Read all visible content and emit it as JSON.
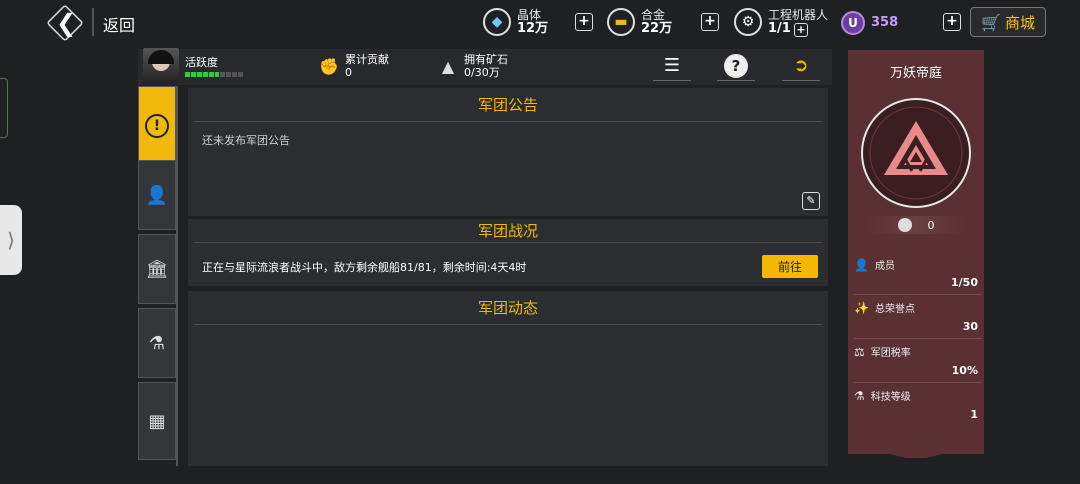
{
  "topbar": {
    "back_label": "返回",
    "resources": [
      {
        "name": "晶体",
        "value": "12万",
        "icon": "crystal-icon"
      },
      {
        "name": "合金",
        "value": "22万",
        "icon": "alloy-icon"
      },
      {
        "name": "工程机器人",
        "value": "1/1",
        "icon": "robot-icon"
      }
    ],
    "premium": {
      "icon_letter": "U",
      "value": "358",
      "color": "#c59cf5"
    },
    "shop_label": "商城",
    "accent": "#f0b90b"
  },
  "info": {
    "activity_label": "活跃度",
    "activity_level": 0.55,
    "contribution_label": "累计贡献",
    "contribution_value": "0",
    "ore_label": "拥有矿石",
    "ore_value": "0/30万"
  },
  "notice": {
    "title": "军团公告",
    "text": "还未发布军团公告"
  },
  "battle": {
    "title": "军团战况",
    "text": "正在与星际流浪者战斗中，敌方剩余舰船81/81，剩余时间:4天4时",
    "go_label": "前往"
  },
  "activity_feed": {
    "title": "军团动态"
  },
  "guild": {
    "name": "万妖帝庭",
    "score": "0",
    "stats": [
      {
        "label": "成员",
        "value": "1/50"
      },
      {
        "label": "总荣誉点",
        "value": "30"
      },
      {
        "label": "军团税率",
        "value": "10%"
      },
      {
        "label": "科技等级",
        "value": "1"
      }
    ],
    "panel_color": "#5a3033",
    "emblem_color": "#e88a8a"
  }
}
